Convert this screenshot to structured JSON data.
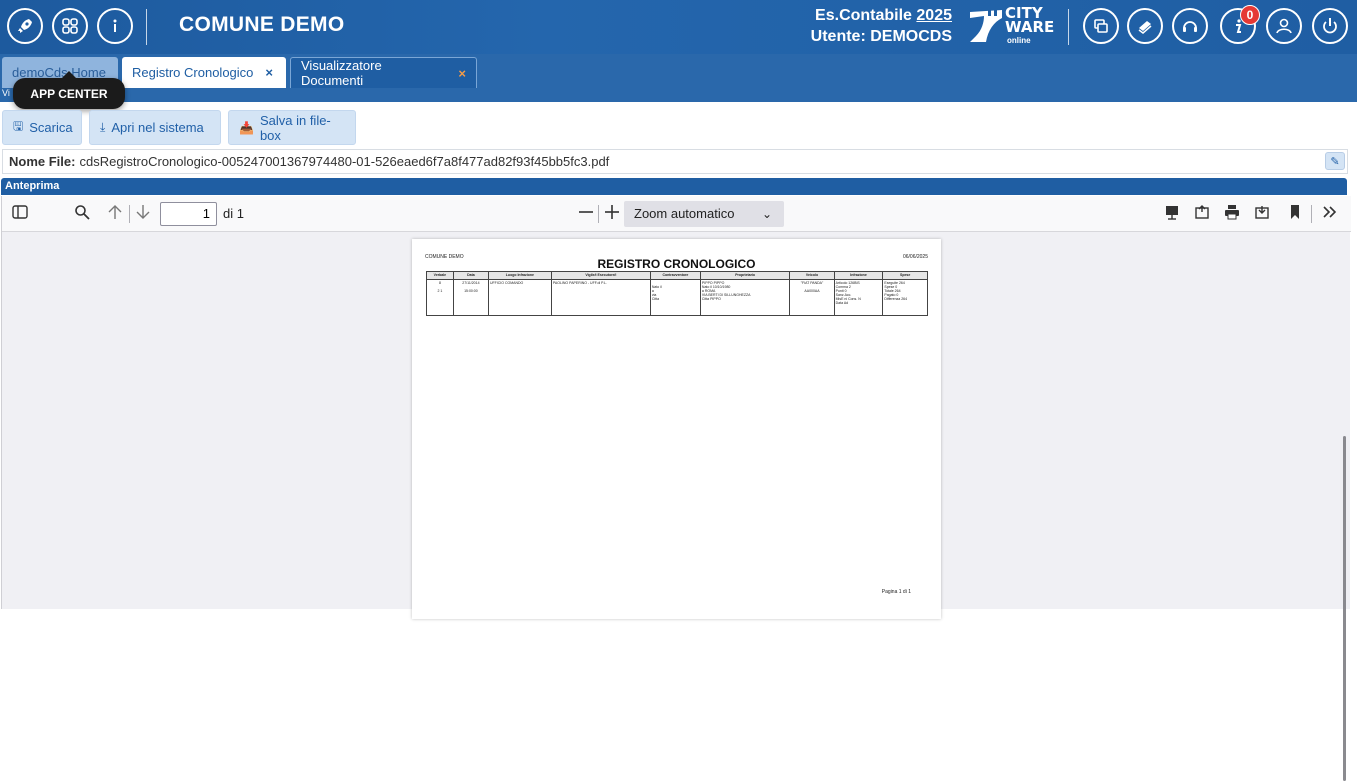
{
  "topbar": {
    "title": "COMUNE DEMO",
    "es_label": "Es.Contabile",
    "es_year": "2025",
    "user_line": "Utente: DEMOCDS",
    "logo_line1": "CITY",
    "logo_line2": "WARE",
    "logo_line3": "online",
    "notification_count": "0"
  },
  "tabs": [
    {
      "label": "demoCds Home"
    },
    {
      "label": "Registro Cronologico",
      "close": "×"
    },
    {
      "label": "Visualizzatore Documenti",
      "close": "×"
    }
  ],
  "subbar_text": "Vi",
  "tooltip": "APP CENTER",
  "toolbar": {
    "download_label": "Scarica",
    "open_label": "Apri nel sistema",
    "save_label": "Salva in file-box"
  },
  "file": {
    "label": "Nome File:",
    "value": "cdsRegistroCronologico-005247001367974480-01-526eaed6f7a8f477ad82f93f45bb5fc3.pdf"
  },
  "preview_header": "Anteprima",
  "viewer": {
    "page_number": "1",
    "page_total": "di 1",
    "zoom": "Zoom automatico"
  },
  "pdf": {
    "header_left": "COMUNE DEMO",
    "title": "REGISTRO CRONOLOGICO",
    "date": "06/06/2025",
    "columns": [
      "Verbale",
      "Data",
      "Luogo Infrazione",
      "Vigile/i Esecutore/i",
      "Contravventore",
      "Proprietario",
      "Veicolo",
      "Infrazione",
      "Spese"
    ],
    "row": [
      "8\n\n2    1",
      "27/11/2014\n\n15:00:00",
      "UFFICIO COMANDO",
      "PAOLINO PAPERINO - UFF.di P.L.",
      "\nNato il\na\nvia\nCitta",
      "PIPPO PIPPO\nNato il 10/10/1980\na ROMA\nVIA BERTI DI SILLUNGHEZZA\nCitta PIPPO",
      "\"FIAT PANDA\"\n\nAA000AA",
      "Articolo 126BIS\nComma 2\nPunti 0\nSanz.Acc.\nMisE ni    Cons. N\nData Ad",
      "Eseguite 264\nSpese 0\nTotale 264\nPagato 0\nDifferenza 264"
    ],
    "footer": "Pagina 1 di 1"
  },
  "colors": {
    "primary": "#1f5ea3",
    "button_bg": "#d4e4f5",
    "badge": "#e53935",
    "tab_close_active": "#f39c4a"
  }
}
